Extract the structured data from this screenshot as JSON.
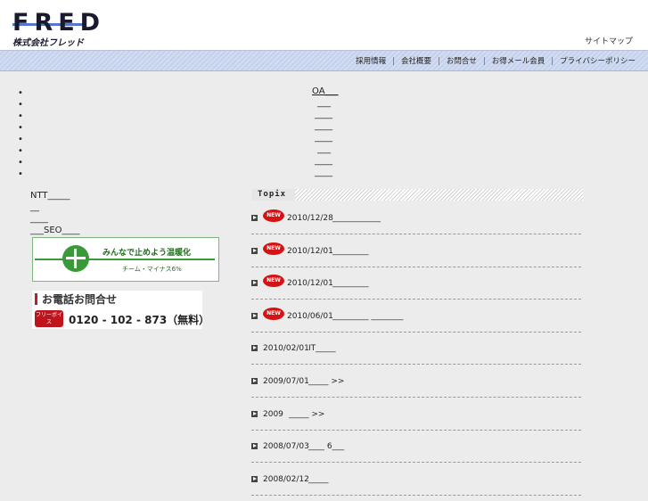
{
  "header": {
    "logo_text": "FRED",
    "logo_sub": "株式会社フレッド",
    "sitemap": "サイトマップ"
  },
  "nav": {
    "items": [
      "採用情報",
      "会社概要",
      "お問合せ",
      "お得メール会員",
      "プライバシーポリシー"
    ],
    "separator": "|"
  },
  "bullets": [
    "",
    "",
    "",
    "",
    "",
    "",
    "",
    ""
  ],
  "center_links": [
    "OA___",
    "___",
    "____",
    "____",
    "____",
    "___",
    "____",
    "____"
  ],
  "left_links": [
    "NTT_____",
    "__",
    "____",
    "___SEO____"
  ],
  "eco_banner": {
    "title": "みんなで止めよう温暖化",
    "subtitle": "チーム・マイナス6%"
  },
  "phone": {
    "title": "お電話お問合せ",
    "badge": "フリーボイス",
    "number": "0120 - 102 - 873（無料）"
  },
  "topix": {
    "heading": "Topix",
    "new_badge": "NEW",
    "items": [
      {
        "date": "2010/12/28",
        "title": "____________",
        "is_new": true
      },
      {
        "date": "2010/12/01",
        "title": "_________",
        "is_new": true
      },
      {
        "date": "2010/12/01",
        "title": "_________",
        "is_new": true
      },
      {
        "date": "2010/06/01",
        "title": "_________ ________",
        "is_new": true
      },
      {
        "date": "2010/02/01",
        "title": "IT_____",
        "is_new": false
      },
      {
        "date": "2009/07/01",
        "title": "_____ >>",
        "is_new": false
      },
      {
        "date": "2009",
        "title": "_____ >>",
        "is_new": false
      },
      {
        "date": "2008/07/03",
        "title": "____ 6___",
        "is_new": false
      },
      {
        "date": "2008/02/12",
        "title": "_____",
        "is_new": false
      }
    ]
  }
}
